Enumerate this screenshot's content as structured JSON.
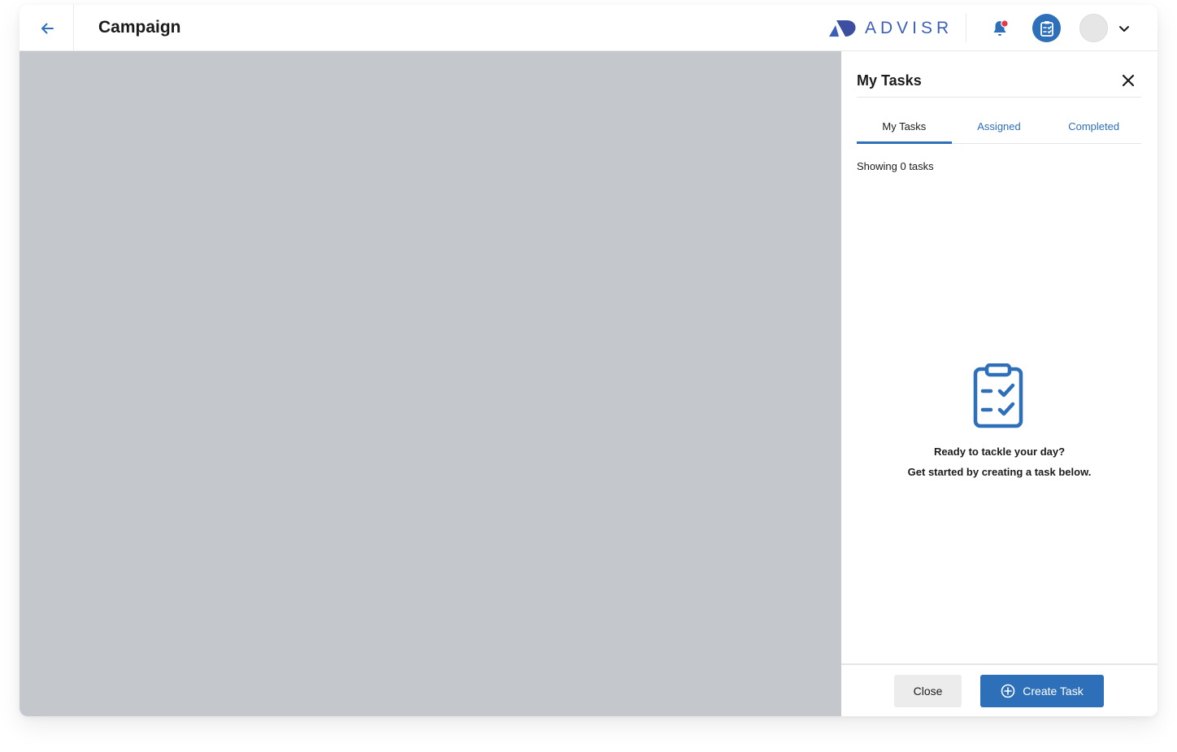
{
  "header": {
    "title": "Campaign",
    "logo_text": "ADVISR",
    "back_icon": "arrow-left-icon",
    "notification_icon": "bell-icon",
    "tasks_icon": "clipboard-icon",
    "has_notification_dot": true
  },
  "panel": {
    "title": "My Tasks",
    "tabs": [
      {
        "label": "My Tasks",
        "active": true
      },
      {
        "label": "Assigned",
        "active": false
      },
      {
        "label": "Completed",
        "active": false
      }
    ],
    "showing": "Showing 0 tasks",
    "empty": {
      "icon": "clipboard-check-icon",
      "line1": "Ready to tackle your day?",
      "line2": "Get started by creating a task below."
    },
    "footer": {
      "close_label": "Close",
      "create_label": "Create Task"
    }
  },
  "colors": {
    "accent": "#2e6fba",
    "overlay": "#c4c7cb",
    "notification_dot": "#e53946"
  }
}
